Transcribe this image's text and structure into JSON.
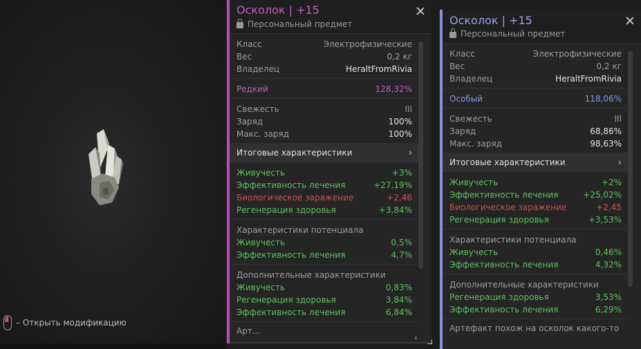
{
  "hint": {
    "text": "– Открыть модификацию"
  },
  "panels": [
    {
      "title": "Осколок | +15",
      "subtitle": "Персональный предмет",
      "props": [
        {
          "k": "Класс",
          "v": "Электрофизические"
        },
        {
          "k": "Вес",
          "v": "0,2 кг"
        },
        {
          "k": "Владелец",
          "v": "HeraltFromRivia"
        }
      ],
      "rarity": {
        "k": "Редкий",
        "v": "128,32%"
      },
      "state": [
        {
          "k": "Свежесть",
          "v": "III"
        },
        {
          "k": "Заряд",
          "v": "100%"
        },
        {
          "k": "Макс. заряд",
          "v": "100%"
        }
      ],
      "totals_label": "Итоговые характеристики",
      "totals": [
        {
          "k": "Живучесть",
          "v": "+3%",
          "c": "g"
        },
        {
          "k": "Эффективность лечения",
          "v": "+27,19%",
          "c": "g"
        },
        {
          "k": "Биологическое заражение",
          "v": "+2,46",
          "c": "r"
        },
        {
          "k": "Регенерация здоровья",
          "v": "+3,84%",
          "c": "g"
        }
      ],
      "potential_label": "Характеристики потенциала",
      "potential": [
        {
          "k": "Живучесть",
          "v": "0,5%"
        },
        {
          "k": "Эффективность лечения",
          "v": "4,7%"
        }
      ],
      "extra_label": "Дополнительные характеристики",
      "extra": [
        {
          "k": "Живучесть",
          "v": "0,83%"
        },
        {
          "k": "Регенерация здоровья",
          "v": "3,84%"
        },
        {
          "k": "Эффективность лечения",
          "v": "6,84%"
        }
      ],
      "trail": "Арт..."
    },
    {
      "title": "Осколок | +15",
      "subtitle": "Персональный предмет",
      "props": [
        {
          "k": "Класс",
          "v": "Электрофизические"
        },
        {
          "k": "Вес",
          "v": "0,2 кг"
        },
        {
          "k": "Владелец",
          "v": "HeraltFromRivia"
        }
      ],
      "rarity": {
        "k": "Особый",
        "v": "118,06%"
      },
      "state": [
        {
          "k": "Свежесть",
          "v": "III"
        },
        {
          "k": "Заряд",
          "v": "68,86%"
        },
        {
          "k": "Макс. заряд",
          "v": "98,63%"
        }
      ],
      "totals_label": "Итоговые характеристики",
      "totals": [
        {
          "k": "Живучесть",
          "v": "+2%",
          "c": "g"
        },
        {
          "k": "Эффективность лечения",
          "v": "+25,02%",
          "c": "g"
        },
        {
          "k": "Биологическое заражение",
          "v": "+2,45",
          "c": "r"
        },
        {
          "k": "Регенерация здоровья",
          "v": "+3,53%",
          "c": "g"
        }
      ],
      "potential_label": "Характеристики потенциала",
      "potential": [
        {
          "k": "Живучесть",
          "v": "0,46%"
        },
        {
          "k": "Эффективность лечения",
          "v": "4,32%"
        }
      ],
      "extra_label": "Дополнительные характеристики",
      "extra": [
        {
          "k": "Регенерация здоровья",
          "v": "3,53%"
        },
        {
          "k": "Эффективность лечения",
          "v": "6,29%"
        }
      ],
      "trail": "Артефакт похож на осколок какого-то"
    }
  ],
  "colors": {
    "rare": "#c65ec6",
    "special": "#8f96e6",
    "positive": "#5ec25e",
    "negative": "#d15151"
  }
}
